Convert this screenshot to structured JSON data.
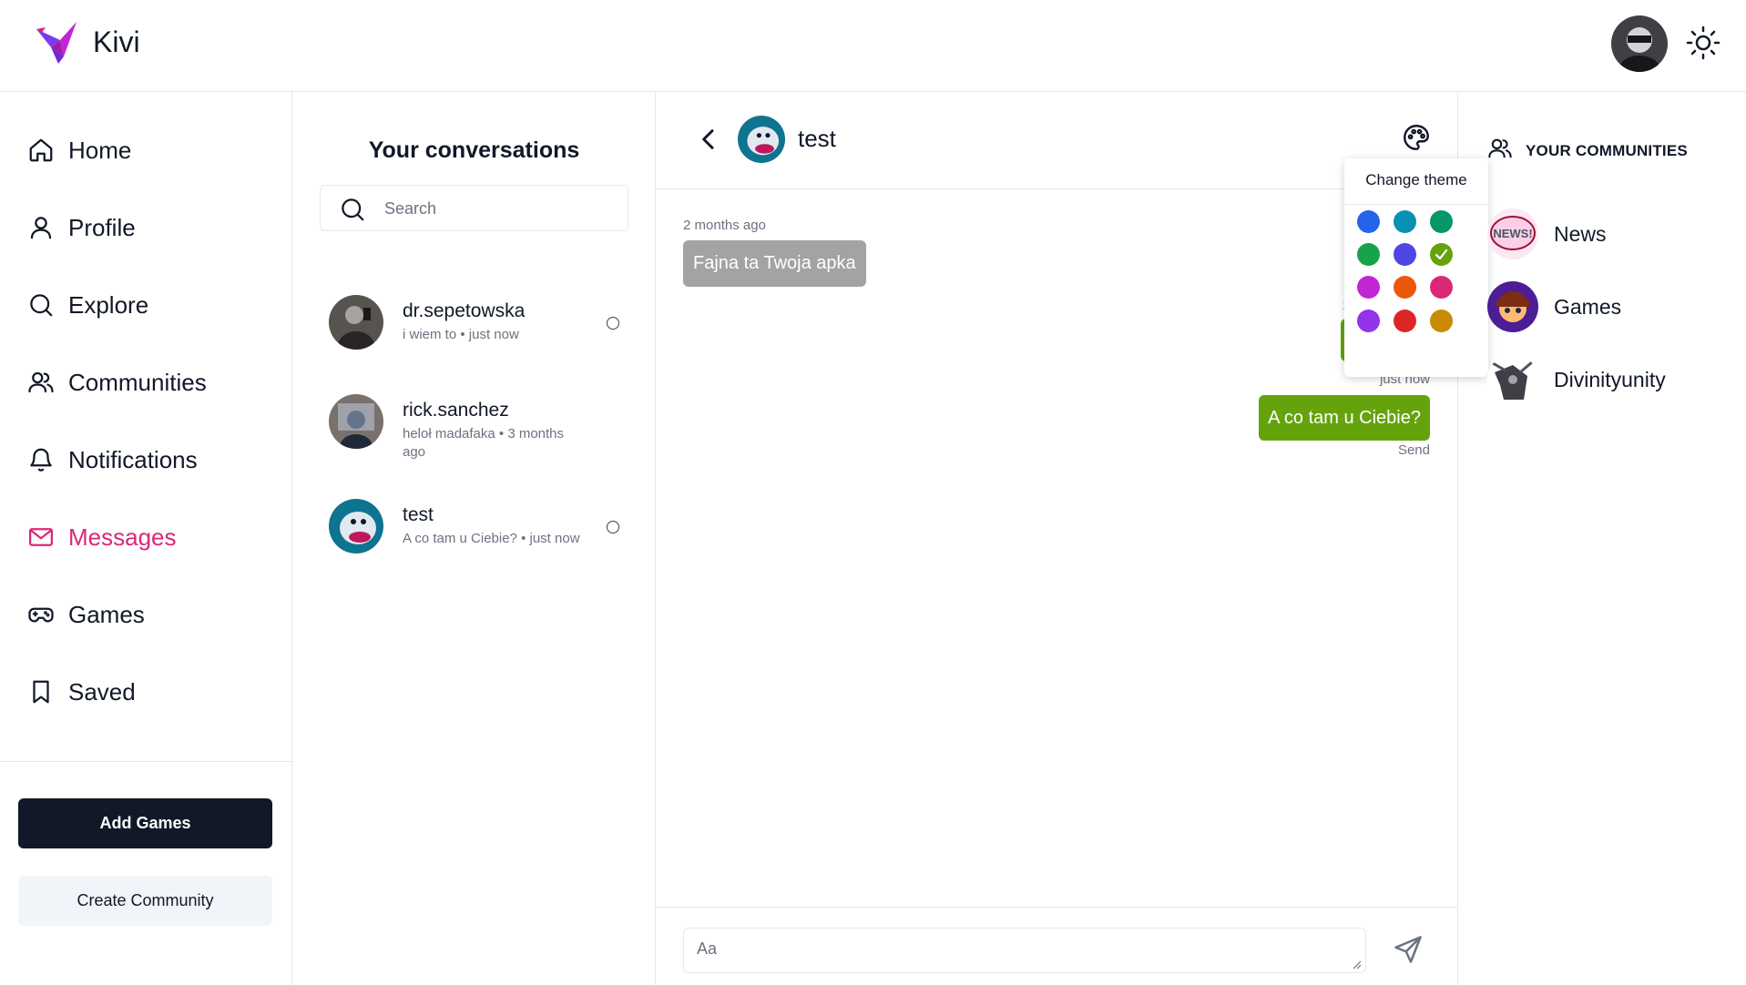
{
  "app": {
    "brand": "Kivi"
  },
  "nav": [
    {
      "label": "Home",
      "icon": "home-icon"
    },
    {
      "label": "Profile",
      "icon": "user-icon"
    },
    {
      "label": "Explore",
      "icon": "search-icon"
    },
    {
      "label": "Communities",
      "icon": "users-icon"
    },
    {
      "label": "Notifications",
      "icon": "bell-icon"
    },
    {
      "label": "Messages",
      "icon": "mail-icon",
      "active": true
    },
    {
      "label": "Games",
      "icon": "gamepad-icon"
    },
    {
      "label": "Saved",
      "icon": "bookmark-icon"
    }
  ],
  "sidebar_buttons": {
    "add_games": "Add Games",
    "create_community": "Create Community"
  },
  "conversations": {
    "title": "Your conversations",
    "search_placeholder": "Search",
    "items": [
      {
        "name": "dr.sepetowska",
        "preview": "i wiem to",
        "time": "just now"
      },
      {
        "name": "rick.sanchez",
        "preview": "heloł madafaka",
        "time": "3 months ago"
      },
      {
        "name": "test",
        "preview": "A co tam u Ciebie?",
        "time": "just now"
      }
    ]
  },
  "chat": {
    "contact": "test",
    "messages": [
      {
        "direction": "in",
        "time": "2 months ago",
        "text": "Fajna ta Twoja apka"
      },
      {
        "direction": "out",
        "time": "just now",
        "text": "A co tam u Ciebie?",
        "status": "Send"
      }
    ],
    "composer_placeholder": "Aa"
  },
  "theme_popup": {
    "title": "Change theme",
    "colors": [
      "#2563eb",
      "#0891b2",
      "#059669",
      "#16a34a",
      "#4f46e5",
      "#65a30d",
      "#c026d3",
      "#ea580c",
      "#db2777",
      "#9333ea",
      "#dc2626",
      "#ca8a04"
    ],
    "selected": "#65a30d"
  },
  "communities": {
    "title": "YOUR COMMUNITIES",
    "items": [
      {
        "name": "News"
      },
      {
        "name": "Games"
      },
      {
        "name": "Divinityunity"
      }
    ]
  },
  "colors": {
    "accent": "#db2777",
    "bubble_out": "#65a30d",
    "bubble_in": "#a3a3a3",
    "primary_button": "#111827"
  }
}
